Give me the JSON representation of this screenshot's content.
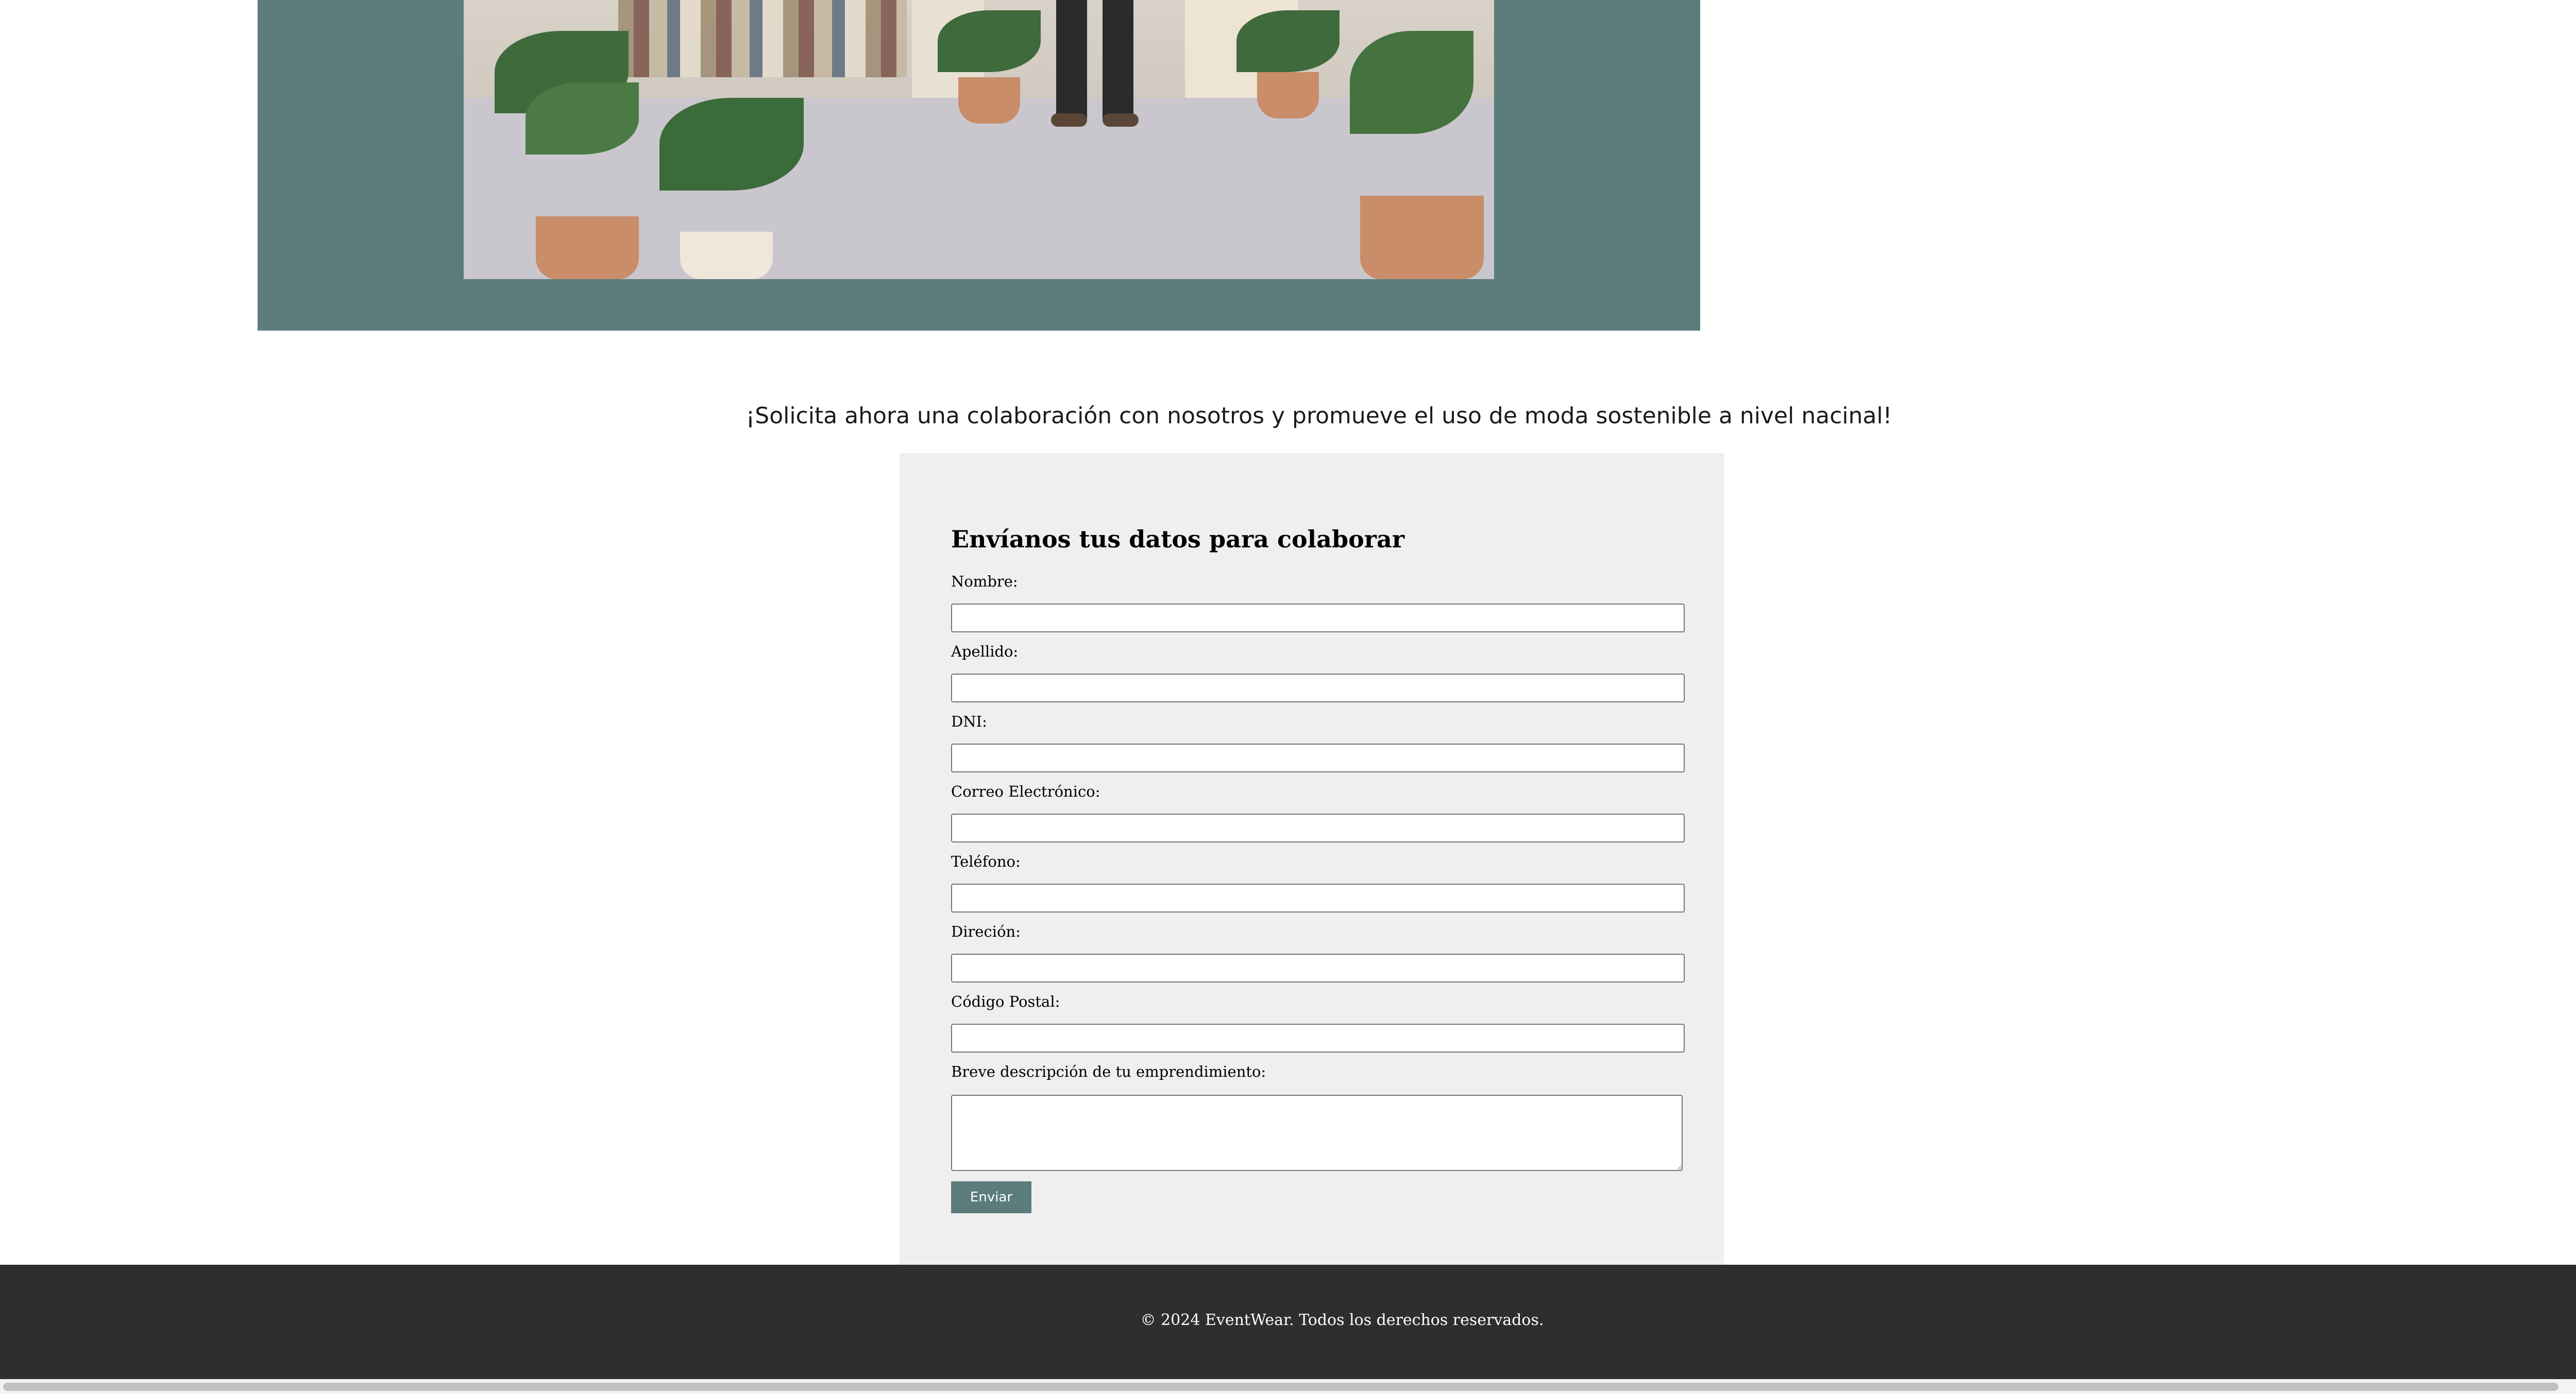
{
  "hero": {
    "image_alt": "Tienda de ropa sostenible con plantas"
  },
  "intro": {
    "text": "¡Solicita ahora una colaboración con nosotros y promueve el uso de moda sostenible a nivel nacinal!"
  },
  "form": {
    "title": "Envíanos tus datos para colaborar",
    "fields": [
      {
        "label": "Nombre:",
        "value": ""
      },
      {
        "label": "Apellido:",
        "value": ""
      },
      {
        "label": "DNI:",
        "value": ""
      },
      {
        "label": "Correo Electrónico:",
        "value": ""
      },
      {
        "label": "Teléfono:",
        "value": ""
      },
      {
        "label": "Direción:",
        "value": ""
      },
      {
        "label": "Código Postal:",
        "value": ""
      }
    ],
    "description": {
      "label": "Breve descripción de tu emprendimiento:",
      "value": ""
    },
    "submit_label": "Enviar"
  },
  "footer": {
    "text": "© 2024 EventWear. Todos los derechos reservados."
  },
  "colors": {
    "accent": "#5c7c7c",
    "panel": "#efefef",
    "footer": "#2e2e2e"
  }
}
